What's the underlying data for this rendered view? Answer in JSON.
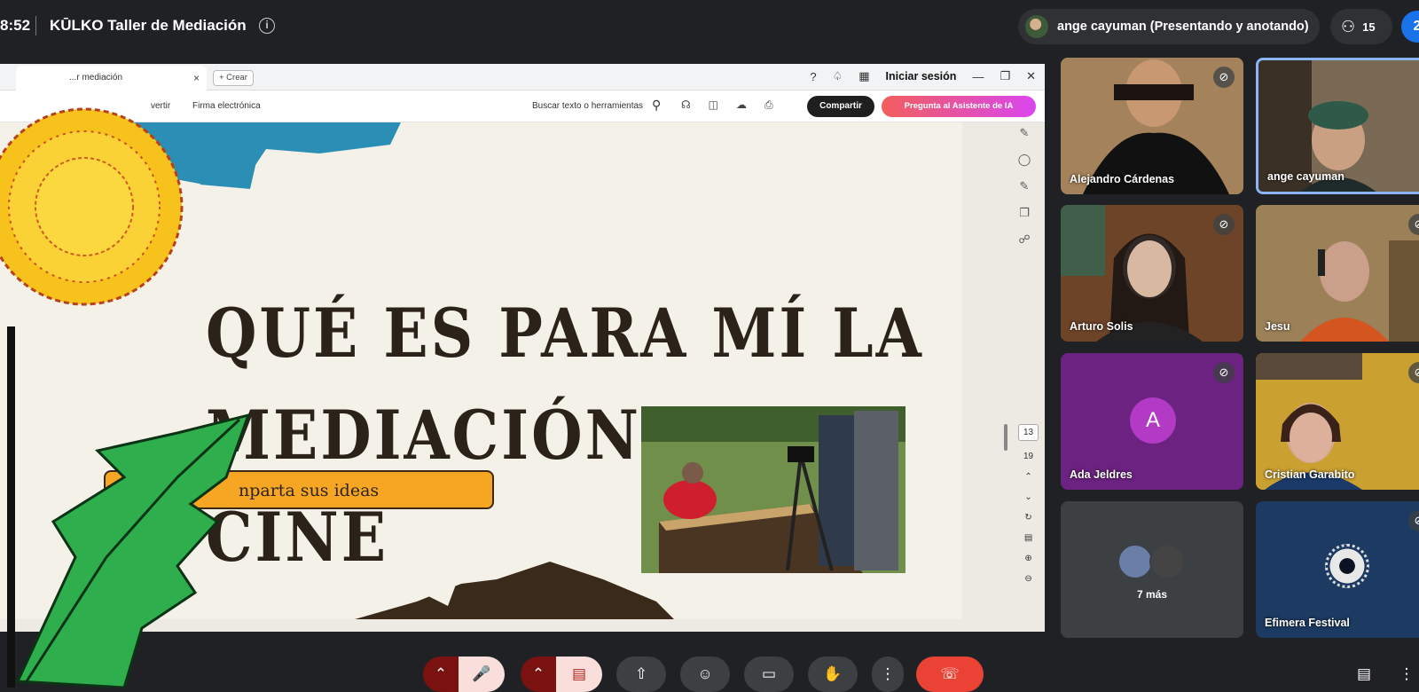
{
  "header": {
    "time": "8:52",
    "meeting_title": "KŪLKO Taller de Mediación",
    "presenter_label": "ange cayuman (Presentando y anotando)",
    "people_count": "15",
    "self_initial": "2"
  },
  "browser": {
    "tab_title": "...r mediación",
    "new_tab_label": "+ Crear",
    "signin_label": "Iniciar sesión",
    "tools": {
      "convert": "vertir",
      "firma": "Firma electrónica",
      "search": "Buscar texto o herramientas",
      "share_label": "Compartir",
      "ai_label": "Pregunta al Asistente de IA"
    },
    "pager": {
      "page_current": "13",
      "page_total": "19"
    }
  },
  "slide": {
    "title_line1": "QUÉ ES PARA MÍ LA",
    "title_line2": "MEDIACIÓN DE CINE",
    "button_text": "nparta sus ideas"
  },
  "participants": [
    {
      "name": "Alejandro Cárdenas",
      "muted": true
    },
    {
      "name": "ange cayuman",
      "muted": false
    },
    {
      "name": "Arturo Solis",
      "muted": true
    },
    {
      "name": "Jesu",
      "muted": true
    },
    {
      "name": "Ada Jeldres",
      "muted": true,
      "initial": "A"
    },
    {
      "name": "Cristian Garabito",
      "muted": true
    },
    {
      "name": "7 más"
    },
    {
      "name": "Efimera Festival",
      "muted": true
    }
  ],
  "colors": {
    "meet_bg": "#202124",
    "end_call": "#ea4335",
    "slide_bg": "#f4f2e8",
    "slide_button": "#f6a623",
    "avatar_purple": "#b33ac4"
  }
}
